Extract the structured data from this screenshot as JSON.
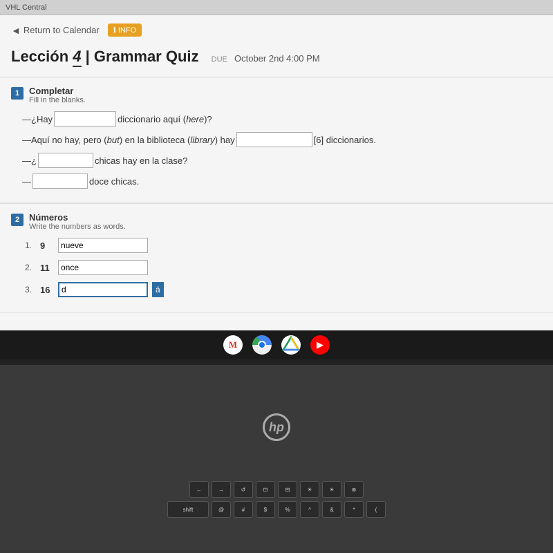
{
  "browser": {
    "title": "VHL Central"
  },
  "nav": {
    "return_label": "Return to Calendar",
    "info_label": "INFO"
  },
  "page": {
    "title_part1": "Lección",
    "title_number": "4",
    "title_part2": "| Grammar Quiz",
    "due_label": "DUE",
    "due_date": "October 2nd 4:00 PM"
  },
  "section1": {
    "number": "1",
    "title": "Completar",
    "subtitle": "Fill in the blanks.",
    "lines": [
      {
        "before": "—¿Hay",
        "input_value": "",
        "after": "diccionario aquí (here)?"
      },
      {
        "before": "—Aquí no hay, pero (but) en la biblioteca (library) hay",
        "input_value": "",
        "after": "[6] diccionarios."
      },
      {
        "before": "—¿",
        "input_value": "",
        "after": "chicas hay en la clase?"
      },
      {
        "before": "—",
        "input_value": "",
        "after": "doce chicas."
      }
    ]
  },
  "section2": {
    "number": "2",
    "title": "Números",
    "subtitle": "Write the numbers as words.",
    "items": [
      {
        "index": "1.",
        "number": "9",
        "value": "nueve"
      },
      {
        "index": "2.",
        "number": "11",
        "value": "once"
      },
      {
        "index": "3.",
        "number": "16",
        "value": "d",
        "active": true
      }
    ]
  },
  "taskbar": {
    "icons": [
      "✉",
      "●",
      "▲",
      "▶"
    ]
  },
  "keyboard": {
    "row1": [
      "←",
      "→",
      "↺",
      "⊡",
      "⊟",
      "°",
      "○",
      "⊗"
    ],
    "row2": [
      "@",
      "#",
      "$",
      "%",
      "^",
      "&",
      "*",
      "("
    ]
  },
  "hp_logo": "hp"
}
